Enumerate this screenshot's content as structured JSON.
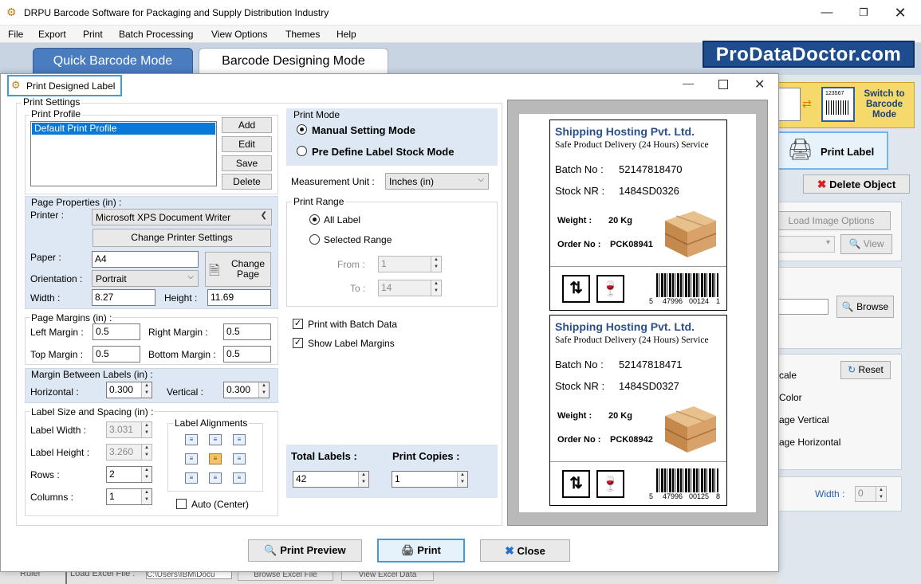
{
  "app": {
    "title": "DRPU Barcode Software for Packaging and Supply Distribution Industry",
    "menu": [
      "File",
      "Export",
      "Print",
      "Batch Processing",
      "View Options",
      "Themes",
      "Help"
    ],
    "tabs": {
      "quick": "Quick Barcode Mode",
      "designing": "Barcode Designing Mode"
    },
    "logo": "ProDataDoctor.com"
  },
  "right_panel": {
    "switch_label": "Switch to Barcode Mode",
    "switch_badge": "123567",
    "print_label": "Print Label",
    "delete_object": "Delete Object",
    "load_image_options": "Load Image Options",
    "view": "View",
    "browse": "Browse",
    "reset": "Reset",
    "items": [
      "cale",
      "Color",
      "age Vertical",
      "age Horizontal"
    ],
    "width_label": "Width :",
    "width_value": "0"
  },
  "behind": {
    "ruler": "Ruler",
    "load_excel": "Load Excel File :",
    "excel_path": "C:\\Users\\IBM\\Docu",
    "browse_excel": "Browse Excel File",
    "view_excel": "View Excel Data"
  },
  "dialog": {
    "title": "Print Designed Label",
    "print_settings": "Print Settings",
    "print_profile": {
      "legend": "Print Profile",
      "items": [
        "Default Print Profile"
      ],
      "buttons": {
        "add": "Add",
        "edit": "Edit",
        "save": "Save",
        "delete": "Delete"
      }
    },
    "page_properties": {
      "legend": "Page Properties (in) :",
      "printer_label": "Printer :",
      "printer_value": "Microsoft XPS Document Writer",
      "change_printer": "Change Printer Settings",
      "paper_label": "Paper :",
      "paper_value": "A4",
      "change_page": "Change Page",
      "orientation_label": "Orientation :",
      "orientation_value": "Portrait",
      "width_label": "Width :",
      "width_value": "8.27",
      "height_label": "Height :",
      "height_value": "11.69"
    },
    "page_margins": {
      "legend": "Page Margins (in) :",
      "left_label": "Left Margin :",
      "left_value": "0.5",
      "right_label": "Right Margin :",
      "right_value": "0.5",
      "top_label": "Top Margin :",
      "top_value": "0.5",
      "bottom_label": "Bottom Margin :",
      "bottom_value": "0.5"
    },
    "margin_between": {
      "legend": "Margin Between Labels (in) :",
      "horizontal_label": "Horizontal :",
      "horizontal_value": "0.300",
      "vertical_label": "Vertical :",
      "vertical_value": "0.300"
    },
    "label_size": {
      "legend": "Label Size and Spacing (in) :",
      "width_label": "Label Width :",
      "width_value": "3.031",
      "height_label": "Label Height :",
      "height_value": "3.260",
      "rows_label": "Rows :",
      "rows_value": "2",
      "columns_label": "Columns :",
      "columns_value": "1",
      "alignments_legend": "Label Alignments",
      "auto_center": "Auto (Center)"
    },
    "print_mode": {
      "legend": "Print Mode",
      "manual": "Manual Setting Mode",
      "predefine": "Pre Define Label Stock Mode"
    },
    "measurement_unit_label": "Measurement Unit :",
    "measurement_unit_value": "Inches (in)",
    "print_range": {
      "legend": "Print Range",
      "all": "All Label",
      "selected": "Selected Range",
      "from_label": "From :",
      "from_value": "1",
      "to_label": "To :",
      "to_value": "14"
    },
    "print_with_batch": "Print with Batch Data",
    "show_label_margins": "Show Label Margins",
    "total_labels_label": "Total Labels :",
    "total_labels_value": "42",
    "print_copies_label": "Print Copies :",
    "print_copies_value": "1",
    "buttons": {
      "preview": "Print Preview",
      "print": "Print",
      "close": "Close"
    }
  },
  "labels": [
    {
      "company": "Shipping Hosting Pvt. Ltd.",
      "service": "Safe Product Delivery (24 Hours) Service",
      "batch_label": "Batch No :",
      "batch_value": "52147818470",
      "stock_label": "Stock NR :",
      "stock_value": "1484SD0326",
      "weight_label": "Weight :",
      "weight_value": "20 Kg",
      "order_label": "Order No :",
      "order_value": "PCK08941",
      "barcode_text": [
        "5",
        "47996",
        "00124",
        "1"
      ]
    },
    {
      "company": "Shipping Hosting Pvt. Ltd.",
      "service": "Safe Product Delivery (24 Hours) Service",
      "batch_label": "Batch No :",
      "batch_value": "52147818471",
      "stock_label": "Stock NR :",
      "stock_value": "1484SD0327",
      "weight_label": "Weight :",
      "weight_value": "20 Kg",
      "order_label": "Order No :",
      "order_value": "PCK08942",
      "barcode_text": [
        "5",
        "47996",
        "00125",
        "8"
      ]
    }
  ]
}
